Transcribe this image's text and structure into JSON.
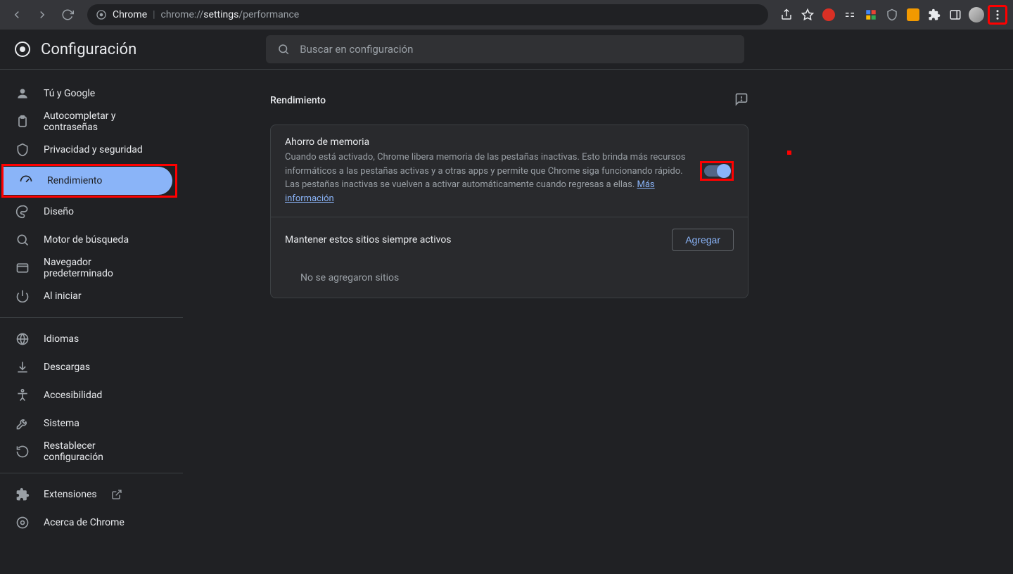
{
  "toolbar": {
    "url_prefix": "chrome://",
    "url_bold": "settings",
    "url_suffix": "/performance",
    "chrome_label": "Chrome"
  },
  "header": {
    "title": "Configuración",
    "search_placeholder": "Buscar en configuración"
  },
  "sidebar": {
    "group1": [
      {
        "icon": "person",
        "label": "Tú y Google"
      },
      {
        "icon": "clipboard",
        "label": "Autocompletar y contraseñas"
      },
      {
        "icon": "shield",
        "label": "Privacidad y seguridad"
      },
      {
        "icon": "speed",
        "label": "Rendimiento",
        "active": true
      },
      {
        "icon": "palette",
        "label": "Diseño"
      },
      {
        "icon": "search",
        "label": "Motor de búsqueda"
      },
      {
        "icon": "window",
        "label": "Navegador predeterminado"
      },
      {
        "icon": "power",
        "label": "Al iniciar"
      }
    ],
    "group2": [
      {
        "icon": "globe",
        "label": "Idiomas"
      },
      {
        "icon": "download",
        "label": "Descargas"
      },
      {
        "icon": "accessibility",
        "label": "Accesibilidad"
      },
      {
        "icon": "wrench",
        "label": "Sistema"
      },
      {
        "icon": "restore",
        "label": "Restablecer configuración"
      }
    ],
    "group3": [
      {
        "icon": "extension",
        "label": "Extensiones",
        "external": true
      },
      {
        "icon": "chrome",
        "label": "Acerca de Chrome"
      }
    ]
  },
  "main": {
    "section_title": "Rendimiento",
    "memory": {
      "title": "Ahorro de memoria",
      "desc": "Cuando está activado, Chrome libera memoria de las pestañas inactivas. Esto brinda más recursos informáticos a las pestañas activas y a otras apps y permite que Chrome siga funcionando rápido. Las pestañas inactivas se vuelven a activar automáticamente cuando regresas a ellas. ",
      "learn_more": "Más información",
      "toggle_on": true
    },
    "always_active": {
      "title": "Mantener estos sitios siempre activos",
      "add_button": "Agregar",
      "empty": "No se agregaron sitios"
    }
  }
}
